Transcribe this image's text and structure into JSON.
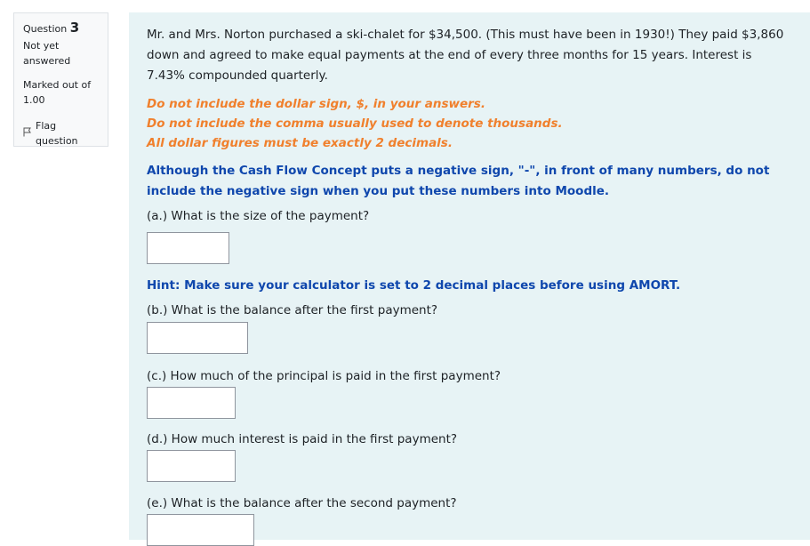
{
  "info": {
    "question_label": "Question",
    "question_number": "3",
    "state": "Not yet answered",
    "grade": "Marked out of 1.00",
    "flag_label": "Flag question"
  },
  "question": {
    "text": "Mr. and Mrs. Norton purchased a ski-chalet for $34,500. (This must have been in 1930!)  They paid $3,860 down and agreed to make equal payments at the end of every three months for 15 years.  Interest is 7.43% compounded quarterly.",
    "instructions": [
      "Do not include the dollar sign, $, in your answers.",
      "Do not include the comma usually used to denote thousands.",
      "All dollar figures must be exactly 2 decimals."
    ],
    "note": "Although the Cash Flow Concept puts a negative sign, \"-\", in front of many numbers, do not include the negative sign when you put these numbers into Moodle.",
    "hint": "Hint: Make sure your calculator is set to 2 decimal places before using AMORT.",
    "parts": [
      {
        "label": "(a.) What is the size of the payment?",
        "value": ""
      },
      {
        "label": "(b.) What is the balance after the first payment?",
        "value": ""
      },
      {
        "label": "(c.) How much of the principal is paid in the first payment?",
        "value": ""
      },
      {
        "label": "(d.) How much interest is paid in the first payment?",
        "value": ""
      },
      {
        "label": "(e.) What is the balance after the second payment?",
        "value": ""
      }
    ]
  },
  "colors": {
    "panel_bg": "#e7f3f5",
    "instruction_orange": "#f0802d",
    "note_blue": "#0f47ad"
  }
}
